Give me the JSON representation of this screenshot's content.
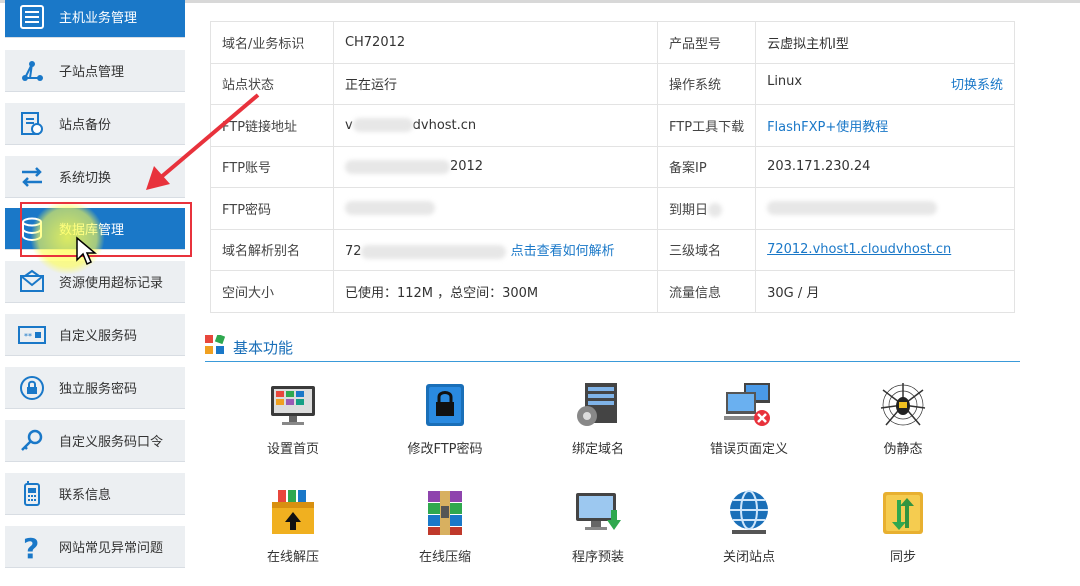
{
  "sidebar": {
    "items": [
      {
        "label": "主机业务管理",
        "icon": "server-list-icon"
      },
      {
        "label": "子站点管理",
        "icon": "branch-icon"
      },
      {
        "label": "站点备份",
        "icon": "backup-icon"
      },
      {
        "label": "系统切换",
        "icon": "switch-icon"
      },
      {
        "label": "数据库管理",
        "icon": "database-icon"
      },
      {
        "label": "资源使用超标记录",
        "icon": "mail-icon"
      },
      {
        "label": "自定义服务码",
        "icon": "code-icon"
      },
      {
        "label": "独立服务密码",
        "icon": "lock-icon"
      },
      {
        "label": "自定义服务码口令",
        "icon": "key-icon"
      },
      {
        "label": "联系信息",
        "icon": "phone-icon"
      },
      {
        "label": "网站常见异常问题",
        "icon": "help-icon"
      }
    ]
  },
  "info": {
    "domain_label": "域名/业务标识",
    "domain_value": "CH72012",
    "product_label": "产品型号",
    "product_value": "云虚拟主机I型",
    "status_label": "站点状态",
    "status_value": "正在运行",
    "os_label": "操作系统",
    "os_value": "Linux",
    "os_switch": "切换系统",
    "ftp_addr_label": "FTP链接地址",
    "ftp_addr_value_start": "v",
    "ftp_addr_value_end": "dvhost.cn",
    "ftp_tool_label": "FTP工具下载",
    "ftp_tool_link": "FlashFXP+使用教程",
    "ftp_account_label": "FTP账号",
    "ftp_account_value_end": "2012",
    "beian_label": "备案IP",
    "beian_value": "203.171.230.24",
    "ftp_pwd_label": "FTP密码",
    "expire_label": "到期日",
    "alias_label": "域名解析别名",
    "alias_value_start": "72",
    "alias_link": "点击查看如何解析",
    "third_label": "三级域名",
    "third_value": "72012.vhost1.cloudvhost.cn",
    "space_label": "空间大小",
    "space_value": "已使用：112M ，总空间：300M",
    "traffic_label": "流量信息",
    "traffic_value": "30G / 月"
  },
  "section": {
    "title": "基本功能"
  },
  "features": [
    {
      "label": "设置首页",
      "icon": "homepage-monitor-icon"
    },
    {
      "label": "修改FTP密码",
      "icon": "ftp-lock-icon"
    },
    {
      "label": "绑定域名",
      "icon": "bind-domain-icon"
    },
    {
      "label": "错误页面定义",
      "icon": "error-page-icon"
    },
    {
      "label": "伪静态",
      "icon": "spider-icon"
    },
    {
      "label": "在线解压",
      "icon": "unzip-icon"
    },
    {
      "label": "在线压缩",
      "icon": "zip-icon"
    },
    {
      "label": "程序预装",
      "icon": "install-icon"
    },
    {
      "label": "关闭站点",
      "icon": "globe-icon"
    },
    {
      "label": "同步",
      "icon": "sync-folder-icon"
    }
  ],
  "colors": {
    "accent": "#1a78c8",
    "annotation": "#e8323c",
    "highlight": "#ffff50"
  }
}
